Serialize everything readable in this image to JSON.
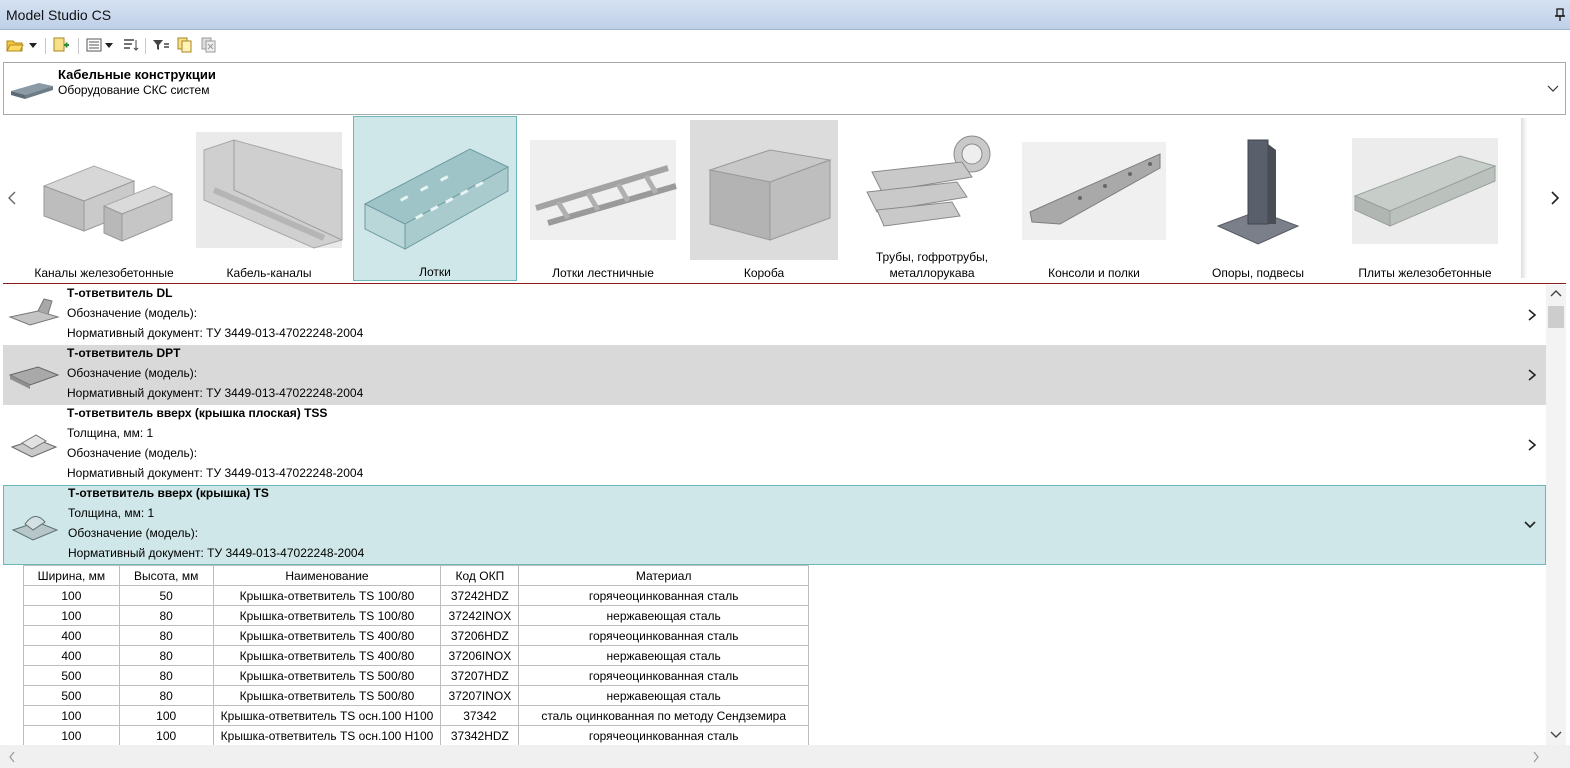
{
  "window": {
    "title": "Model Studio CS"
  },
  "toolbar": {
    "icons": [
      "open-folder-icon",
      "dropdown-arrow-icon",
      "add-item-icon",
      "view-list-icon",
      "dropdown-arrow-icon",
      "sort-icon",
      "filter-icon",
      "copy-icon",
      "delete-copy-icon"
    ]
  },
  "category": {
    "title": "Кабельные конструкции",
    "subtitle": "Оборудование СКС систем"
  },
  "gallery": {
    "tiles": [
      {
        "label": "Каналы железобетонные"
      },
      {
        "label": "Кабель-каналы"
      },
      {
        "label": "Лотки"
      },
      {
        "label": "Лотки лестничные"
      },
      {
        "label": "Короба"
      },
      {
        "label_line1": "Трубы, гофротрубы,",
        "label_line2": "металлорукава"
      },
      {
        "label": "Консоли и полки"
      },
      {
        "label": "Опоры, подвесы"
      },
      {
        "label": "Плиты железобетонные"
      }
    ],
    "selected": "Лотки"
  },
  "list": {
    "items": [
      {
        "title": "Т-ответвитель DL",
        "line1": "Обозначение (модель):",
        "line2": "Нормативный документ: ТУ 3449-013-47022248-2004"
      },
      {
        "title": "Т-ответвитель DPT",
        "line1": "Обозначение (модель):",
        "line2": "Нормативный документ: ТУ 3449-013-47022248-2004"
      },
      {
        "title": "Т-ответвитель вверх (крышка плоская) TSS",
        "line1": "Толщина, мм: 1",
        "line2": "Обозначение (модель):",
        "line3": "Нормативный документ: ТУ 3449-013-47022248-2004"
      },
      {
        "title": "Т-ответвитель вверх (крышка) TS",
        "line1": "Толщина, мм: 1",
        "line2": "Обозначение (модель):",
        "line3": "Нормативный документ: ТУ 3449-013-47022248-2004"
      }
    ]
  },
  "table": {
    "headers": [
      "Ширина, мм",
      "Высота, мм",
      "Наименование",
      "Код ОКП",
      "Материал"
    ],
    "rows": [
      [
        "100",
        "50",
        "Крышка-ответвитель TS  100/80",
        "37242HDZ",
        "горячеоцинкованная сталь"
      ],
      [
        "100",
        "80",
        "Крышка-ответвитель TS  100/80",
        "37242INOX",
        "нержавеющая сталь"
      ],
      [
        "400",
        "80",
        "Крышка-ответвитель TS 400/80",
        "37206HDZ",
        "горячеоцинкованная сталь"
      ],
      [
        "400",
        "80",
        "Крышка-ответвитель TS 400/80",
        "37206INOX",
        "нержавеющая сталь"
      ],
      [
        "500",
        "80",
        "Крышка-ответвитель TS 500/80",
        "37207HDZ",
        "горячеоцинкованная сталь"
      ],
      [
        "500",
        "80",
        "Крышка-ответвитель TS 500/80",
        "37207INOX",
        "нержавеющая сталь"
      ],
      [
        "100",
        "100",
        "Крышка-ответвитель TS осн.100 Н100",
        "37342",
        "сталь оцинкованная по методу Сендземира"
      ],
      [
        "100",
        "100",
        "Крышка-ответвитель TS осн.100 Н100",
        "37342HDZ",
        "горячеоцинкованная сталь"
      ]
    ]
  },
  "colors": {
    "selection": "#cfe7e8",
    "selection_border": "#6fb6b8",
    "title_bar": "#c9d8ee",
    "gallery_divider": "#8b1a1a",
    "gray_row": "#d9d9d9"
  }
}
